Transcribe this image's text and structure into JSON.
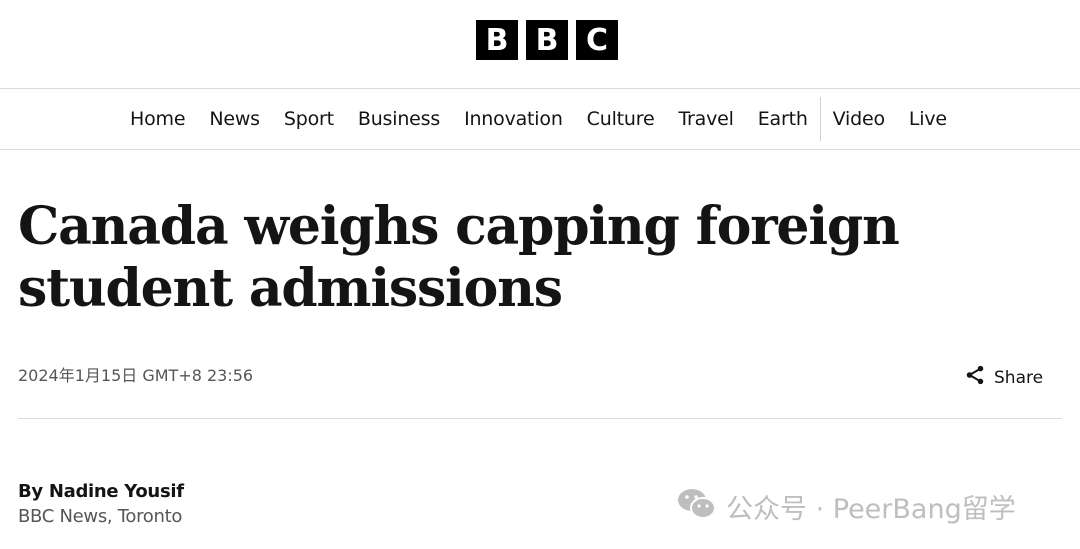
{
  "logo": {
    "letters": [
      "B",
      "B",
      "C"
    ]
  },
  "nav": {
    "items": [
      "Home",
      "News",
      "Sport",
      "Business",
      "Innovation",
      "Culture",
      "Travel",
      "Earth"
    ],
    "items_after_separator": [
      "Video",
      "Live"
    ]
  },
  "article": {
    "headline": "Canada weighs capping foreign student admissions",
    "timestamp": "2024年1月15日 GMT+8 23:56",
    "share_label": "Share",
    "byline": {
      "prefix": "By",
      "author": "Nadine Yousif",
      "role": "BBC News, Toronto"
    }
  },
  "watermark": {
    "text": "公众号 · PeerBang留学",
    "icon": "wechat-icon"
  },
  "colors": {
    "text": "#141414",
    "muted": "#545658",
    "logo_bg": "#000000",
    "divider": "#dcdcdc"
  }
}
